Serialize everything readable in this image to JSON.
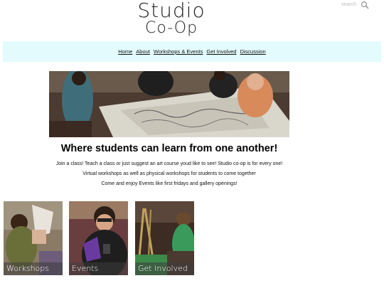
{
  "logo": {
    "line1": "Studio",
    "line2": "Co-Op"
  },
  "search": {
    "placeholder": "search",
    "icon": "search-icon"
  },
  "nav": {
    "items": [
      {
        "label": "Home"
      },
      {
        "label": "About"
      },
      {
        "label": "Workshops & Events"
      },
      {
        "label": "Get Involved"
      },
      {
        "label": "Discussion"
      }
    ],
    "background": "#e3fbfc"
  },
  "main": {
    "headline": "Where students can learn from one another!",
    "paragraphs": [
      "Join a class! Teach a class or just suggest an art course youd like to see! Studio co-op is for every one!",
      "Virtual workshops as well as physical workshops for students to come together",
      "Come and enjoy Events like first fridays and gallery openings!"
    ]
  },
  "tiles": [
    {
      "label": "Workshops"
    },
    {
      "label": "Events"
    },
    {
      "label": "Get Involved"
    }
  ]
}
